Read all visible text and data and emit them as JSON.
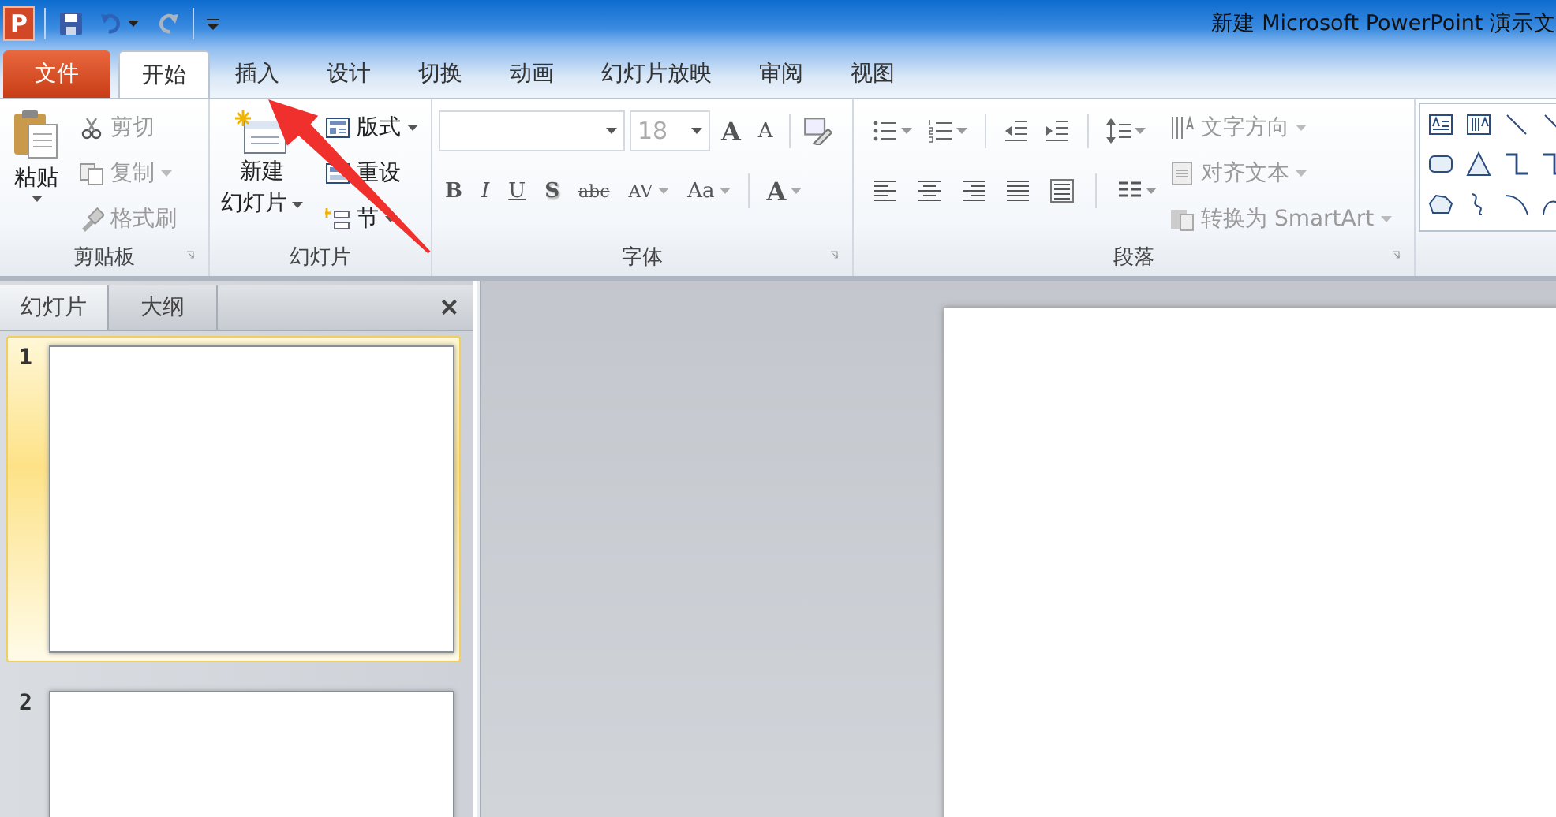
{
  "window": {
    "logo_letter": "P",
    "title": "新建 Microsoft PowerPoint 演示文"
  },
  "tabs": [
    {
      "label": "文件",
      "kind": "file",
      "selected": false
    },
    {
      "label": "开始",
      "kind": "tab",
      "selected": true
    },
    {
      "label": "插入",
      "kind": "tab",
      "selected": false
    },
    {
      "label": "设计",
      "kind": "tab",
      "selected": false
    },
    {
      "label": "切换",
      "kind": "tab",
      "selected": false
    },
    {
      "label": "动画",
      "kind": "tab",
      "selected": false
    },
    {
      "label": "幻灯片放映",
      "kind": "tab",
      "selected": false
    },
    {
      "label": "审阅",
      "kind": "tab",
      "selected": false
    },
    {
      "label": "视图",
      "kind": "tab",
      "selected": false
    }
  ],
  "ribbon": {
    "clipboard": {
      "label": "剪贴板",
      "paste": "粘贴",
      "tools": [
        {
          "label": "剪切",
          "disabled": true,
          "dropdown": false
        },
        {
          "label": "复制",
          "disabled": true,
          "dropdown": true
        },
        {
          "label": "格式刷",
          "disabled": true,
          "dropdown": false
        }
      ]
    },
    "slides": {
      "label": "幻灯片",
      "new_slide": [
        "新建",
        "幻灯片"
      ],
      "tools": [
        {
          "label": "版式",
          "disabled": false,
          "dropdown": true
        },
        {
          "label": "重设",
          "disabled": false,
          "dropdown": false
        },
        {
          "label": "节",
          "disabled": false,
          "dropdown": true
        }
      ]
    },
    "font": {
      "label": "字体",
      "font_size": "18",
      "grow": "A",
      "shrink": "A",
      "format_buttons": [
        {
          "label": "B",
          "kind": "bold",
          "dropdown": false
        },
        {
          "label": "I",
          "kind": "italic",
          "dropdown": false
        },
        {
          "label": "U",
          "kind": "underline",
          "dropdown": false
        },
        {
          "label": "S",
          "kind": "shadow",
          "dropdown": false
        },
        {
          "label": "abc",
          "kind": "strike",
          "dropdown": false
        },
        {
          "label": "AV",
          "kind": "spacing",
          "dropdown": true
        },
        {
          "label": "Aa",
          "kind": "case",
          "dropdown": true
        }
      ],
      "color_button": "A"
    },
    "paragraph": {
      "label": "段落",
      "tools": [
        {
          "label": "文字方向",
          "disabled": true,
          "dropdown": true
        },
        {
          "label": "对齐文本",
          "disabled": true,
          "dropdown": true
        },
        {
          "label": "转换为 SmartArt",
          "disabled": true,
          "dropdown": true
        }
      ]
    }
  },
  "pane": {
    "tabs": [
      {
        "label": "幻灯片",
        "selected": true
      },
      {
        "label": "大纲",
        "selected": false
      }
    ],
    "slides": [
      {
        "number": "1",
        "selected": true
      },
      {
        "number": "2",
        "selected": false
      }
    ]
  }
}
